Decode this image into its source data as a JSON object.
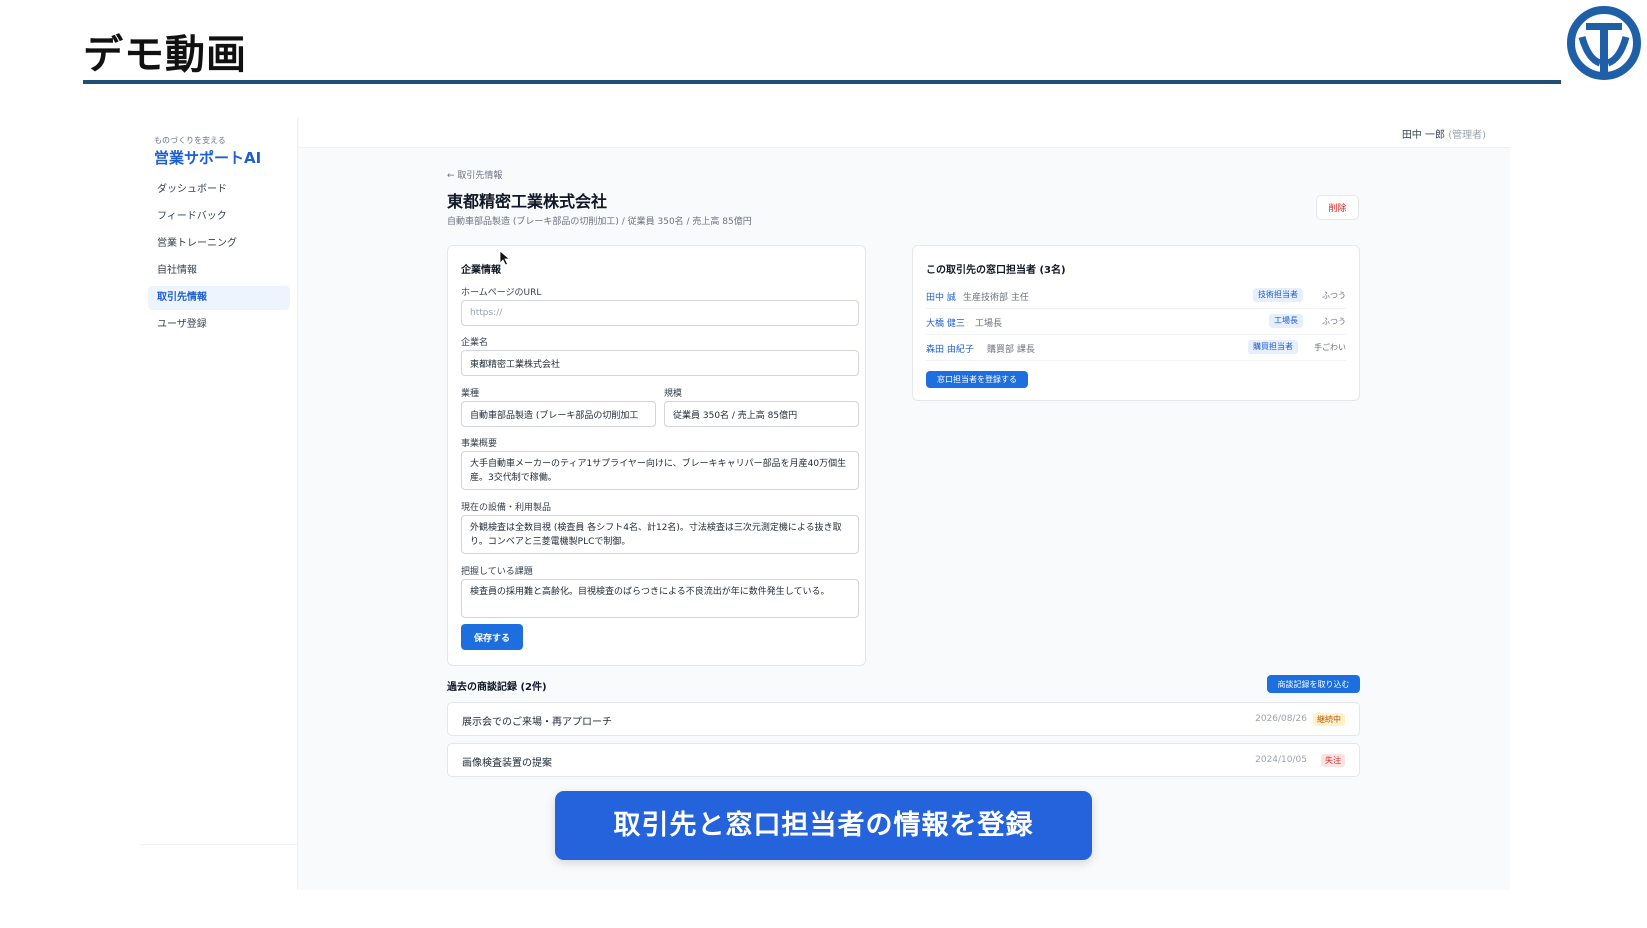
{
  "slide": {
    "title": "デモ動画",
    "caption": "取引先と窓口担当者の情報を登録"
  },
  "colors": {
    "accent": "#1d6fe0",
    "slide_rule": "#1f4e79",
    "caption_bg": "#2563dc"
  },
  "sidebar": {
    "brand_sub": "ものづくりを支える",
    "brand": "営業サポートAI",
    "items": [
      {
        "label": "ダッシュボード",
        "active": false
      },
      {
        "label": "フィードバック",
        "active": false
      },
      {
        "label": "営業トレーニング",
        "active": false
      },
      {
        "label": "自社情報",
        "active": false
      },
      {
        "label": "取引先情報",
        "active": true
      },
      {
        "label": "ユーザ登録",
        "active": false
      }
    ]
  },
  "header": {
    "user_name": "田中 一郎",
    "user_role": "(管理者)"
  },
  "company": {
    "back_link": "← 取引先情報",
    "title": "東都精密工業株式会社",
    "subtitle": "自動車部品製造 (ブレーキ部品の切削加工) / 従業員 350名 / 売上高 85億円",
    "delete_label": "削除"
  },
  "info_card": {
    "heading": "企業情報",
    "url_label": "ホームページのURL",
    "url_placeholder": "https://",
    "name_label": "企業名",
    "name_value": "東都精密工業株式会社",
    "industry_label": "業種",
    "industry_value": "自動車部品製造 (ブレーキ部品の切削加工",
    "scale_label": "規模",
    "scale_value": "従業員 350名 / 売上高 85億円",
    "summary_label": "事業概要",
    "summary_value": "大手自動車メーカーのティア1サプライヤー向けに、ブレーキキャリパー部品を月産40万個生産。3交代制で稼働。",
    "equipment_label": "現在の設備・利用製品",
    "equipment_value": "外観検査は全数目視 (検査員 各シフト4名、計12名)。寸法検査は三次元測定機による抜き取り。コンベアと三菱電機製PLCで制御。",
    "issues_label": "把握している課題",
    "issues_value": "検査員の採用難と高齢化。目視検査のばらつきによる不良流出が年に数件発生している。",
    "save_label": "保存する"
  },
  "contacts_card": {
    "heading": "この取引先の窓口担当者 (3名)",
    "contacts": [
      {
        "name": "田中 誠",
        "role": "生産技術部 主任",
        "tag": "技術担当者",
        "mood": "ふつう"
      },
      {
        "name": "大橋 健三",
        "role": "工場長",
        "tag": "工場長",
        "mood": "ふつう"
      },
      {
        "name": "森田 由紀子",
        "role": "購買部 課長",
        "tag": "購買担当者",
        "mood": "手ごわい"
      }
    ],
    "register_label": "窓口担当者を登録する"
  },
  "history": {
    "title": "過去の商談記録 (2件)",
    "import_label": "商談記録を取り込む",
    "records": [
      {
        "title": "展示会でのご来場・再アプローチ",
        "date": "2026/08/26",
        "status": "継続中",
        "status_type": "ongoing"
      },
      {
        "title": "画像検査装置の提案",
        "date": "2024/10/05",
        "status": "失注",
        "status_type": "lost"
      }
    ]
  }
}
